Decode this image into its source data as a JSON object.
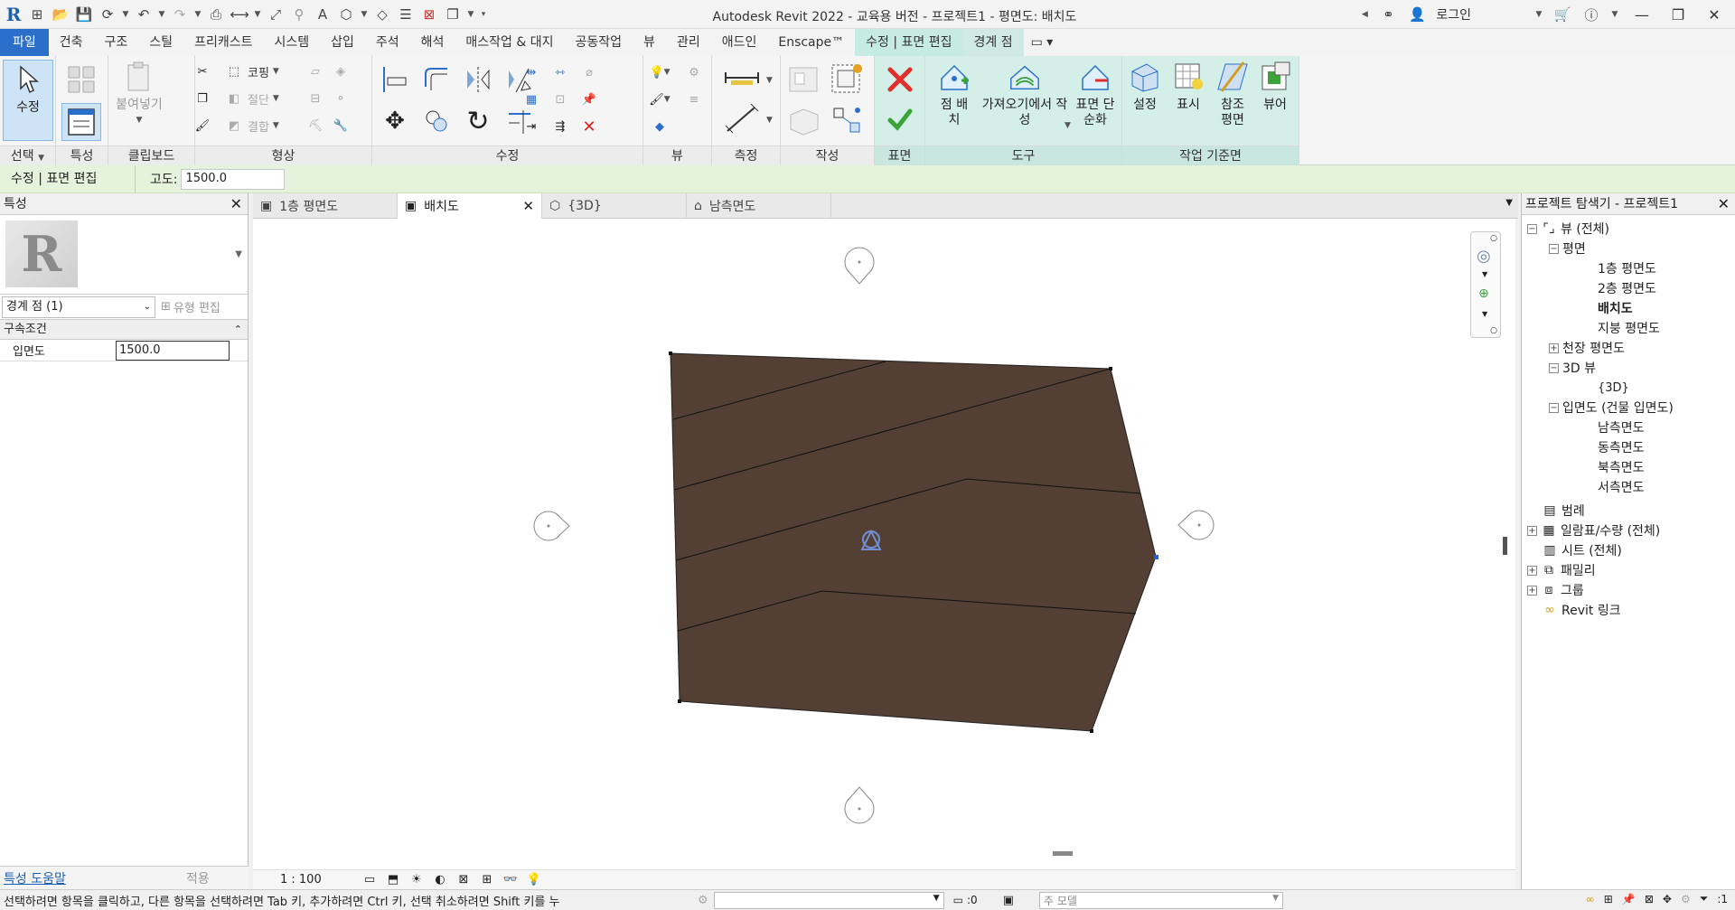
{
  "app": {
    "logo_letter": "R",
    "window_title": "Autodesk Revit 2022 - 교육용 버전 - 프로젝트1 - 평면도: 배치도",
    "login_label": "로그인"
  },
  "tabs": [
    {
      "label": "파일"
    },
    {
      "label": "건축"
    },
    {
      "label": "구조"
    },
    {
      "label": "스틸"
    },
    {
      "label": "프리캐스트"
    },
    {
      "label": "시스템"
    },
    {
      "label": "삽입"
    },
    {
      "label": "주석"
    },
    {
      "label": "해석"
    },
    {
      "label": "매스작업 & 대지"
    },
    {
      "label": "공동작업"
    },
    {
      "label": "뷰"
    },
    {
      "label": "관리"
    },
    {
      "label": "애드인"
    },
    {
      "label": "Enscape™"
    },
    {
      "label": "수정 | 표면 편집"
    },
    {
      "label": "경계 점"
    }
  ],
  "ribbon": {
    "select": {
      "modify": "수정",
      "label": "선택"
    },
    "properties": {
      "label": "특성"
    },
    "clipboard": {
      "paste": "붙여넣기",
      "label": "클립보드"
    },
    "geometry": {
      "cope": "코핑",
      "cut": "절단",
      "join": "결합",
      "label": "형상"
    },
    "modify": {
      "label": "수정"
    },
    "view": {
      "label": "뷰"
    },
    "measure": {
      "label": "측정"
    },
    "create": {
      "label": "작성"
    },
    "surface": {
      "label": "표면"
    },
    "tools": {
      "place_point": "점 배치",
      "import_create": "가져오기에서 작성",
      "simplify_surface": "표면 단순화",
      "label": "도구"
    },
    "workplane": {
      "set": "설정",
      "show": "표시",
      "ref_plane": "참조 평면",
      "viewer": "뷰어",
      "label": "작업 기준면"
    }
  },
  "optionsbar": {
    "context": "수정 | 표면 편집",
    "elevation_label": "고도:",
    "elevation_value": "1500.0"
  },
  "properties": {
    "title": "특성",
    "filter": "경계 점 (1)",
    "edit_type": "유형 편집",
    "group": "구속조건",
    "param_name": "입면도",
    "param_value": "1500.0",
    "help_link": "특성 도움말",
    "apply": "적용"
  },
  "view_tabs": [
    {
      "label": "1층 평면도"
    },
    {
      "label": "배치도"
    },
    {
      "label": "{3D}"
    },
    {
      "label": "남측면도"
    }
  ],
  "view": {
    "scale": "1 : 100",
    "surface_color": "#533f33"
  },
  "browser": {
    "title": "프로젝트 탐색기 - 프로젝트1",
    "items": [
      {
        "label": "뷰 (전체)"
      },
      {
        "label": "평면"
      },
      {
        "label": "1층 평면도"
      },
      {
        "label": "2층 평면도"
      },
      {
        "label": "배치도"
      },
      {
        "label": "지붕 평면도"
      },
      {
        "label": "천장 평면도"
      },
      {
        "label": "3D 뷰"
      },
      {
        "label": "{3D}"
      },
      {
        "label": "입면도 (건물 입면도)"
      },
      {
        "label": "남측면도"
      },
      {
        "label": "동측면도"
      },
      {
        "label": "북측면도"
      },
      {
        "label": "서측면도"
      },
      {
        "label": "범례"
      },
      {
        "label": "일람표/수량 (전체)"
      },
      {
        "label": "시트 (전체)"
      },
      {
        "label": "패밀리"
      },
      {
        "label": "그룹"
      },
      {
        "label": "Revit 링크"
      }
    ]
  },
  "status": {
    "text": "선택하려면 항목을 클릭하고, 다른 항목을 선택하려면 Tab 키, 추가하려면 Ctrl 키, 선택 취소하려면 Shift 키를 누",
    "count": ":0",
    "model": "주 모델",
    "filter_count": ":1"
  }
}
